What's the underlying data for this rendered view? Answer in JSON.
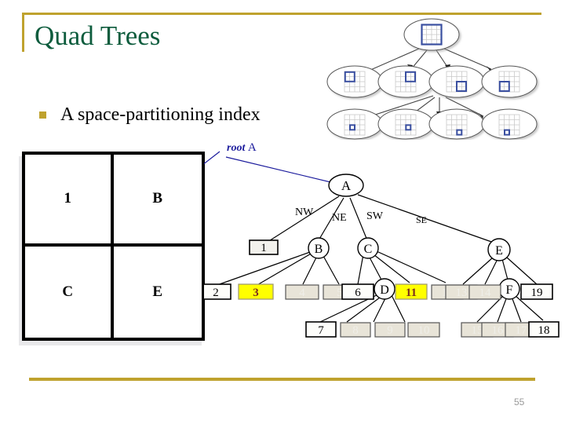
{
  "slide": {
    "title": "Quad Trees",
    "page_number": "55",
    "accent_color": "#bfa22e",
    "title_color": "#0d5c3d",
    "bullets": [
      {
        "text": "A space-partitioning index"
      }
    ]
  },
  "quadrant_square": {
    "cells": [
      {
        "label": "1",
        "quadrant": "NW"
      },
      {
        "label": "B",
        "quadrant": "NE"
      },
      {
        "label": "C",
        "quadrant": "SW"
      },
      {
        "label": "E",
        "quadrant": "SE"
      }
    ]
  },
  "quadtree_picture": {
    "caption": "",
    "levels": [
      {
        "nodes": [
          {
            "highlight": "full"
          }
        ]
      },
      {
        "nodes": [
          {
            "highlight": "nw"
          },
          {
            "highlight": "ne"
          },
          {
            "highlight": "se"
          },
          {
            "highlight": "sw"
          }
        ]
      },
      {
        "nodes": [
          {
            "highlight": "cell"
          },
          {
            "highlight": "cell"
          },
          {
            "highlight": "cell"
          },
          {
            "highlight": "cell"
          }
        ]
      }
    ]
  },
  "tree": {
    "root_annotation": {
      "word1": "root",
      "word2": "A"
    },
    "root": {
      "label": "A",
      "shape": "ellipse"
    },
    "edge_labels": [
      "NW",
      "NE",
      "SW",
      "SE"
    ],
    "nodes": {
      "A": "A",
      "B": "B",
      "C": "C",
      "D": "D",
      "E": "E",
      "F": "F"
    },
    "leaves": [
      {
        "label": "1",
        "style": "plain"
      },
      {
        "label": "2",
        "style": "plain"
      },
      {
        "label": "3",
        "style": "highlight"
      },
      {
        "label": "4",
        "style": "faded"
      },
      {
        "label": "5",
        "style": "faded"
      },
      {
        "label": "6",
        "style": "plain"
      },
      {
        "label": "7",
        "style": "plain"
      },
      {
        "label": "8",
        "style": "faded"
      },
      {
        "label": "9",
        "style": "faded"
      },
      {
        "label": "10",
        "style": "faded"
      },
      {
        "label": "11",
        "style": "highlight"
      },
      {
        "label": "12",
        "style": "faded"
      },
      {
        "label": "13",
        "style": "faded"
      },
      {
        "label": "14",
        "style": "faded"
      },
      {
        "label": "19",
        "style": "plain"
      },
      {
        "label": "15",
        "style": "faded"
      },
      {
        "label": "16",
        "style": "faded"
      },
      {
        "label": "17",
        "style": "faded"
      },
      {
        "label": "18",
        "style": "plain"
      }
    ],
    "highlight_color": "#ffff00",
    "highlight_text_color": "#7a2b1e",
    "faded_fill": "#e8e4d8",
    "faded_text_color": "#efeee8"
  }
}
